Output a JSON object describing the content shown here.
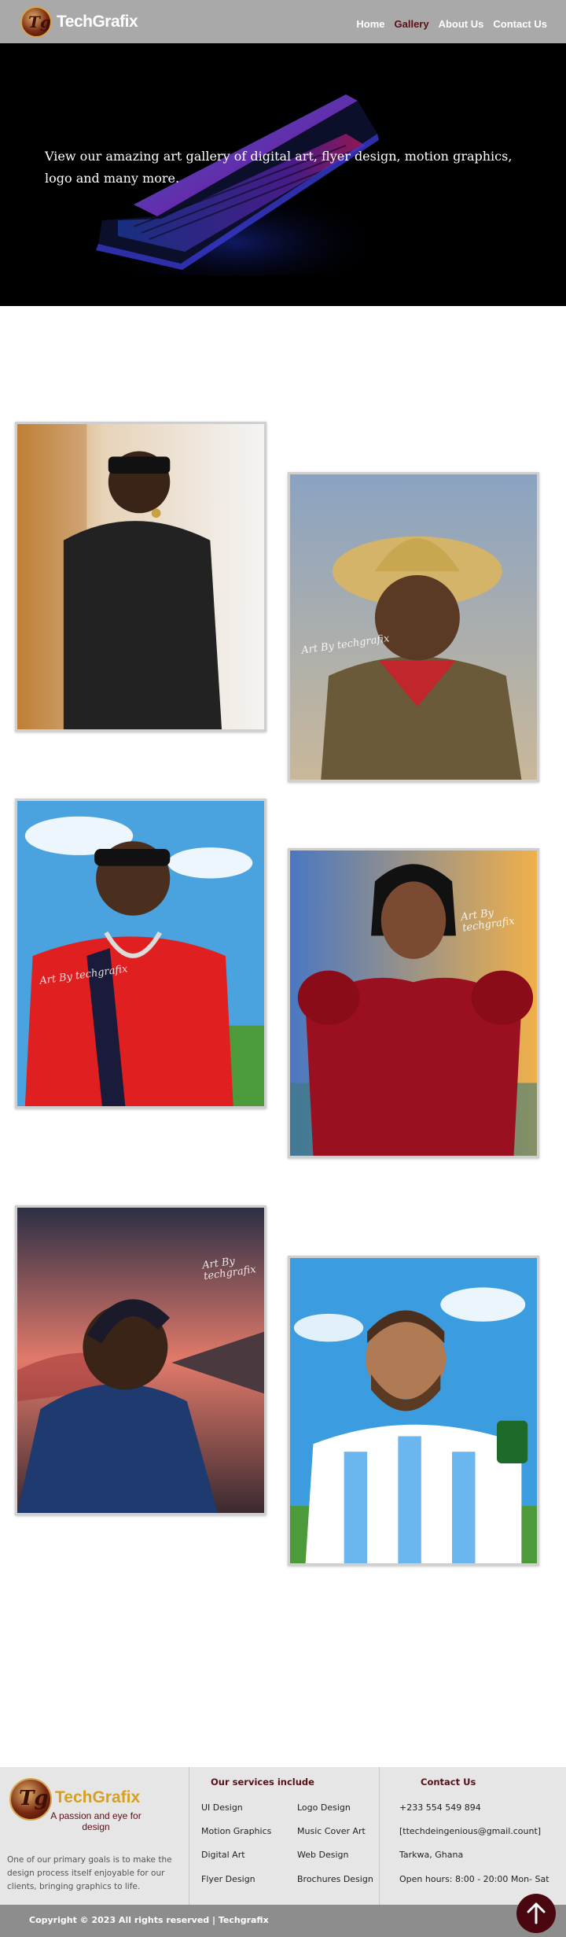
{
  "nav": {
    "brand": "TechGrafix",
    "logo_letters": "Tg",
    "links": [
      {
        "label": "Home"
      },
      {
        "label": "Gallery"
      },
      {
        "label": "About Us"
      },
      {
        "label": "Contact Us"
      }
    ],
    "active": "Gallery"
  },
  "hero": {
    "text": "View our amazing art gallery of digital art, flyer design, motion graphics, logo and many more."
  },
  "gallery": {
    "watermark": "Art By techgrafix",
    "items": [
      {
        "subject": "man in black shirt and sunglasses"
      },
      {
        "subject": "man in straw hat and red bandana"
      },
      {
        "subject": "man in red shirt with chains"
      },
      {
        "subject": "woman in red dress"
      },
      {
        "subject": "man in blue hoodie at sunset"
      },
      {
        "subject": "footballer in striped jersey"
      }
    ]
  },
  "footer": {
    "brand": "TechGrafix",
    "logo_letters": "Tg",
    "tagline": "A passion and eye for design",
    "about": "One of our primary goals is to make the design process itself enjoyable for our clients, bringing graphics to life.",
    "services_heading": "Our services include",
    "services": [
      "UI Design",
      "Logo Design",
      "Motion Graphics",
      "Music Cover Art",
      "Digital Art",
      "Web Design",
      "Flyer Design",
      "Brochures Design"
    ],
    "contact_heading": "Contact Us",
    "phone": "+233 554 549 894",
    "email": "[ttechdeingenious@gmail.count]",
    "location": "Tarkwa, Ghana",
    "hours": "Open hours: 8:00 - 20:00 Mon- Sat",
    "copyright": "Copyright © 2023 All rights reserved | Techgrafix"
  },
  "colors": {
    "nav_bg": "#a9a9a9",
    "accent_maroon": "#5a0f17",
    "brand_gold": "#d6a021",
    "footer_bg": "#e6e6e6",
    "footer_bar": "#8d8d8d"
  },
  "icons": {
    "back_to_top": "arrow-up-icon",
    "logo": "tg-monogram-icon"
  }
}
